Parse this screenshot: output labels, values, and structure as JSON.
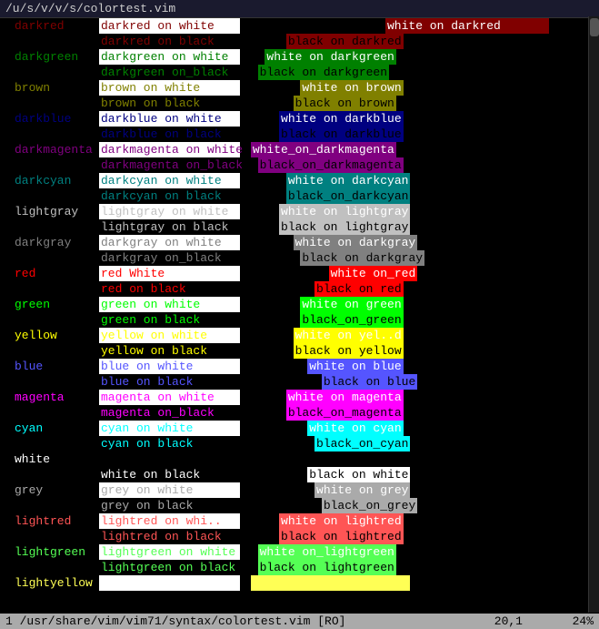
{
  "titlebar": {
    "text": "/u/s/v/v/s/colortest.vim"
  },
  "statusbar": {
    "left": "1 /usr/share/vim/vim71/syntax/colortest.vim [RO]",
    "right": "20,1",
    "far_right": "24%"
  }
}
